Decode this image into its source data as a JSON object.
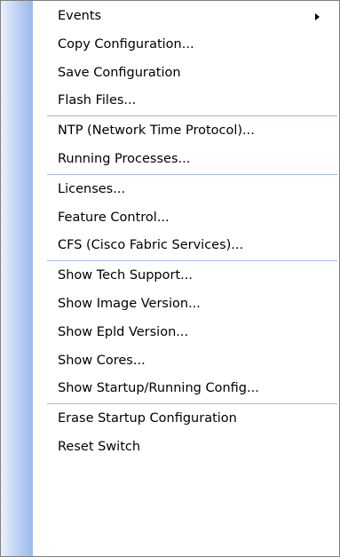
{
  "menu": {
    "items": [
      {
        "label": "Events",
        "submenu": true
      },
      {
        "label": "Copy Configuration..."
      },
      {
        "label": "Save Configuration"
      },
      {
        "label": "Flash Files..."
      },
      {
        "label": "NTP (Network Time Protocol)..."
      },
      {
        "label": "Running Processes..."
      },
      {
        "label": "Licenses..."
      },
      {
        "label": "Feature Control..."
      },
      {
        "label": "CFS (Cisco Fabric Services)..."
      },
      {
        "label": "Show Tech Support..."
      },
      {
        "label": "Show Image Version..."
      },
      {
        "label": "Show Epld Version..."
      },
      {
        "label": "Show Cores..."
      },
      {
        "label": "Show Startup/Running Config..."
      },
      {
        "label": "Erase Startup Configuration"
      },
      {
        "label": "Reset Switch"
      }
    ],
    "submenu_icon": "triangle-right-icon",
    "colors": {
      "gutter": "#9bb8ec",
      "separator": "#a3b9e3",
      "border": "#7f7f7f"
    }
  }
}
